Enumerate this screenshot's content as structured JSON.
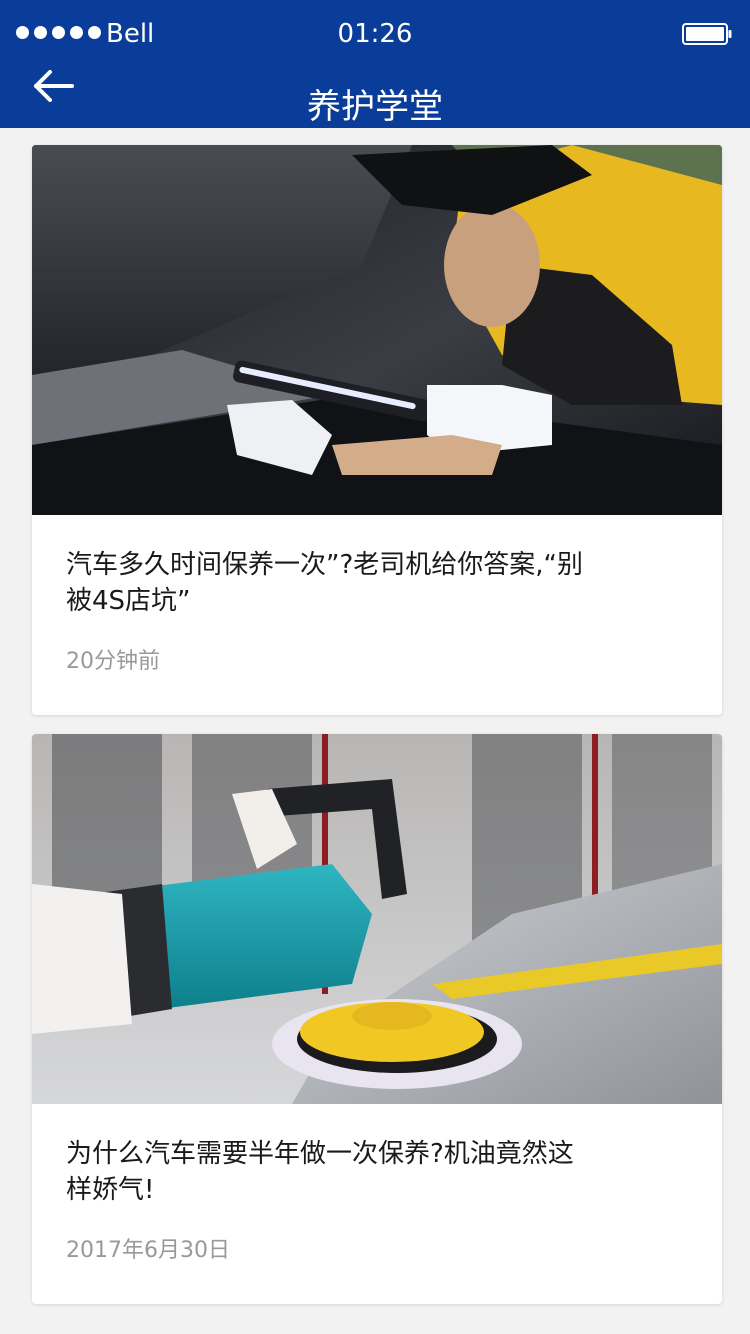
{
  "status_bar": {
    "carrier": "Bell",
    "time": "01:26"
  },
  "nav": {
    "title": "养护学堂",
    "back_icon": "arrow-left-icon"
  },
  "articles": [
    {
      "title": "汽车多久时间保养一次”?老司机给你答案,“别被4S店坑”",
      "time": "20分钟前",
      "image": "mechanic-inspecting-engine-photo"
    },
    {
      "title": "为什么汽车需要半年做一次保养?机油竟然这样娇气!",
      "time": "2017年6月30日",
      "image": "car-polishing-machine-photo"
    }
  ],
  "colors": {
    "header_bg": "#0a3d99",
    "page_bg": "#f2f2f2",
    "title_text": "#1a1a1a",
    "meta_text": "#999999"
  }
}
